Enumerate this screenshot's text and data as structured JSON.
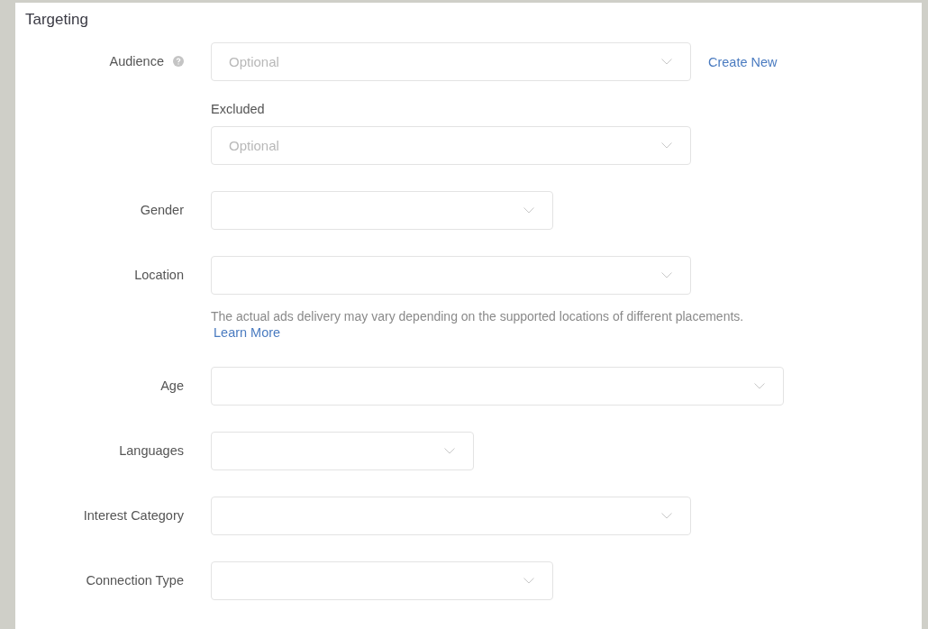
{
  "section": {
    "title": "Targeting"
  },
  "fields": [
    {
      "kind": "inline",
      "label": "Audience",
      "help": true,
      "placeholder": "Optional",
      "link": "Create New"
    },
    {
      "kind": "stacked",
      "label": "Excluded",
      "help": false,
      "placeholder": "Optional"
    },
    {
      "kind": "inline",
      "label": "Gender",
      "help": false
    },
    {
      "kind": "inline",
      "label": "Location",
      "help": false,
      "note": "The actual ads delivery may vary depending on the supported locations of different placements.",
      "note_link": "Learn More"
    },
    {
      "kind": "inline",
      "label": "Age",
      "help": false
    },
    {
      "kind": "inline",
      "label": "Languages",
      "help": false
    },
    {
      "kind": "inline",
      "label": "Interest Category",
      "help": false
    },
    {
      "kind": "inline",
      "label": "Connection Type",
      "help": false
    }
  ]
}
